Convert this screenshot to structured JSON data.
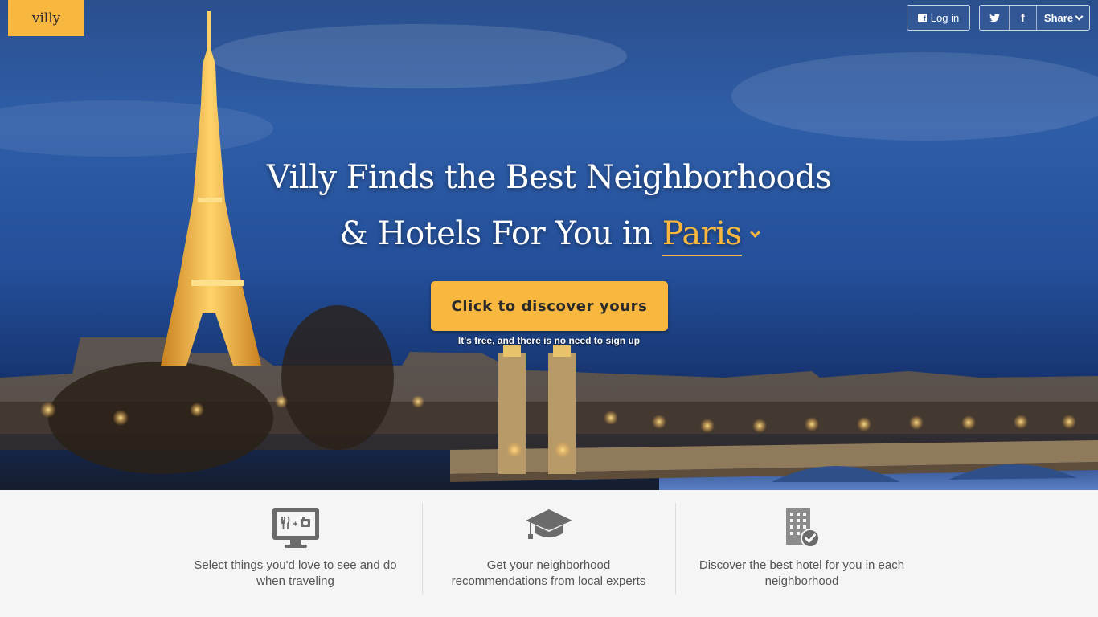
{
  "header": {
    "logo": "villy",
    "login_label": "Log in",
    "share_label": "Share"
  },
  "hero": {
    "line1": "Villy Finds the Best Neighborhoods",
    "line2_prefix": "& Hotels For You in ",
    "city": "Paris",
    "cta_label": "Click to discover yours",
    "cta_subtext": "It's free, and there is no need to sign up"
  },
  "features": [
    {
      "icon": "monitor-food-camera-icon",
      "text": "Select things you'd love to see and do when traveling"
    },
    {
      "icon": "graduation-cap-icon",
      "text": "Get your neighborhood recommendations from local experts"
    },
    {
      "icon": "building-check-icon",
      "text": "Discover the best hotel for you in each neighborhood"
    }
  ],
  "colors": {
    "accent": "#f8b83f",
    "sky": "#2f5ea8",
    "feature_bg": "#f5f5f5",
    "feature_text": "#555555"
  }
}
